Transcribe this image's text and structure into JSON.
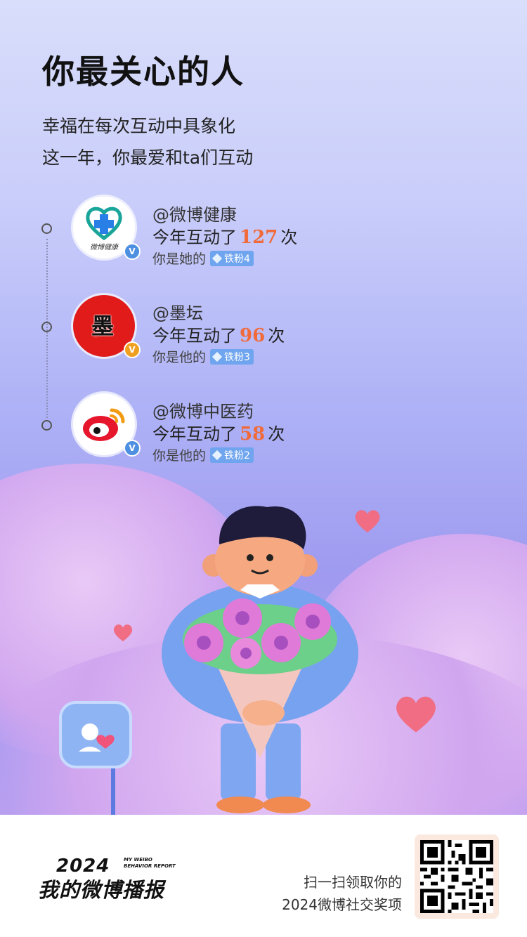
{
  "page": {
    "title": "你最关心的人",
    "subtitle_lines": [
      "幸福在每次互动中具象化",
      "这一年，你最爱和ta们互动"
    ]
  },
  "accounts": [
    {
      "name": "@微博健康",
      "avatar_text": "微博健康",
      "count_prefix": "今年互动了",
      "count": "127",
      "count_suffix": "次",
      "relation": "你是她的",
      "badge": "铁粉4",
      "verify": "V"
    },
    {
      "name": "@墨坛",
      "avatar_text": "墨坛",
      "count_prefix": "今年互动了",
      "count": "96",
      "count_suffix": "次",
      "relation": "你是他的",
      "badge": "铁粉3",
      "verify": "V"
    },
    {
      "name": "@微博中医药",
      "avatar_text": "",
      "count_prefix": "今年互动了",
      "count": "58",
      "count_suffix": "次",
      "relation": "你是他的",
      "badge": "铁粉2",
      "verify": "V"
    }
  ],
  "footer": {
    "year": "2024",
    "report_en_line1": "MY WEIBO",
    "report_en_line2": "BEHAVIOR REPORT",
    "report_cn": "我的微博播报",
    "scan_line1": "扫一扫领取你的",
    "scan_line2": "2024微博社交奖项"
  },
  "colors": {
    "accent_count": "#f06a3a",
    "badge_blue": "#6fa4ef",
    "verify_blue": "#4d8fe0",
    "verify_gold": "#f0a020"
  },
  "icons": [
    "weibo-health-logo-icon",
    "weibo-logo-icon",
    "verified-icon",
    "diamond-icon",
    "heart-icon",
    "qr-code-icon"
  ]
}
